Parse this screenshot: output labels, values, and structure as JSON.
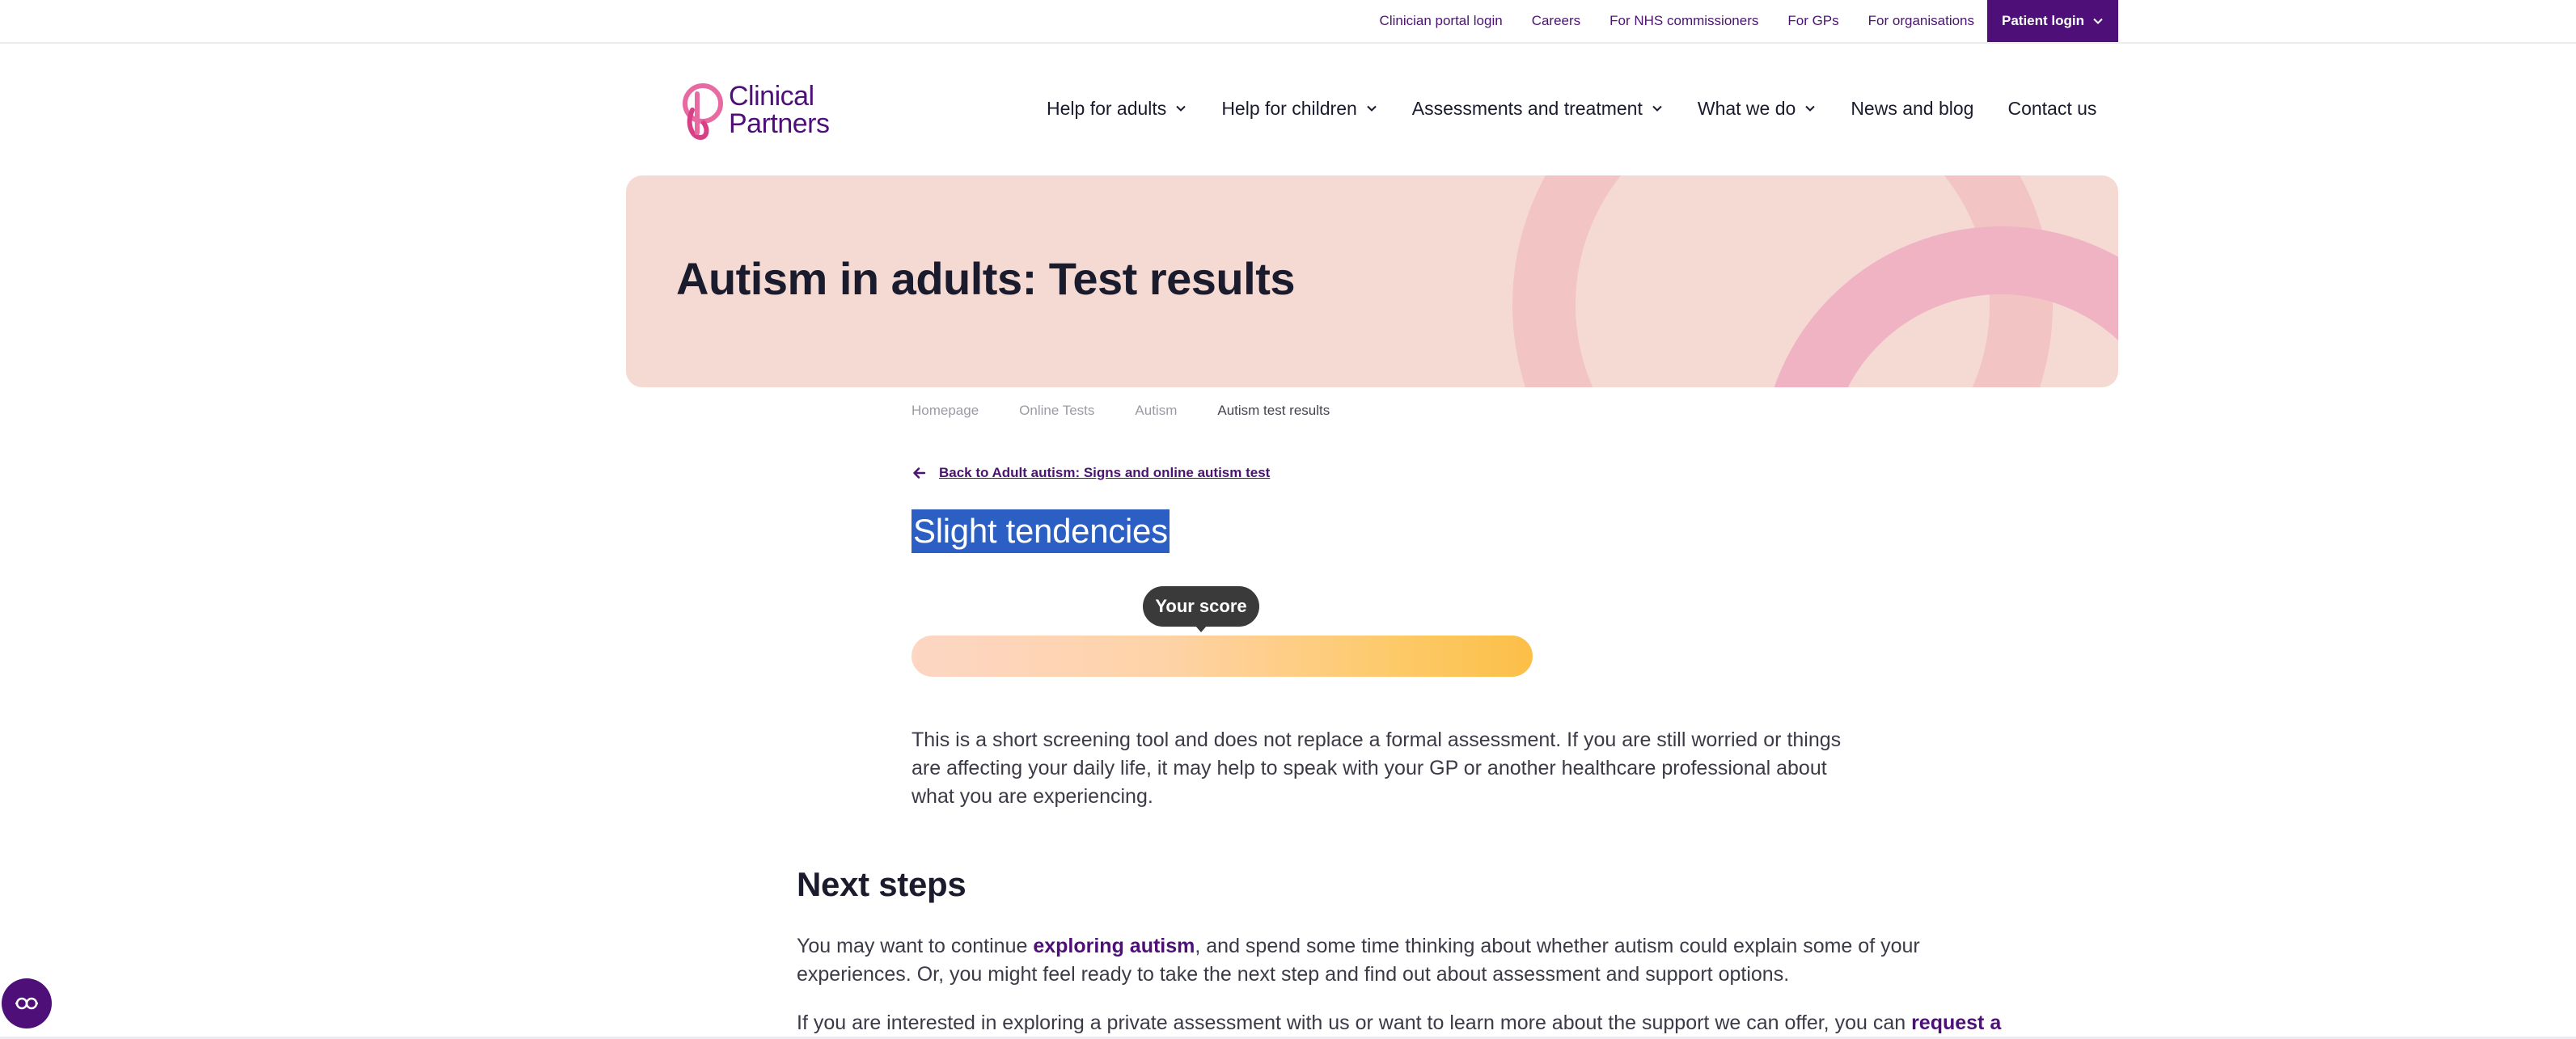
{
  "topbar": {
    "links": [
      "Clinician portal login",
      "Careers",
      "For NHS commissioners",
      "For GPs",
      "For organisations"
    ],
    "patient_login": "Patient login"
  },
  "logo": {
    "line1": "Clinical",
    "line2": "Partners"
  },
  "nav": {
    "items": [
      {
        "label": "Help for adults",
        "dropdown": true
      },
      {
        "label": "Help for children",
        "dropdown": true
      },
      {
        "label": "Assessments and treatment",
        "dropdown": true
      },
      {
        "label": "What we do",
        "dropdown": true
      },
      {
        "label": "News and blog",
        "dropdown": false
      },
      {
        "label": "Contact us",
        "dropdown": false
      }
    ]
  },
  "hero": {
    "title": "Autism in adults: Test results"
  },
  "breadcrumb": [
    "Homepage",
    "Online Tests",
    "Autism",
    "Autism test results"
  ],
  "back_link": "Back to Adult autism: Signs and online autism test",
  "result": {
    "title": "Slight tendencies",
    "tooltip": "Your score"
  },
  "disclaimer": "This is a short screening tool and does not replace a formal assessment. If you are still worried or things are affecting your daily life, it may help to speak with your GP or another healthcare professional about what you are experiencing.",
  "next_steps": {
    "title": "Next steps",
    "p1_before": "You may want to continue ",
    "p1_link": "exploring autism",
    "p1_after": ", and spend some time thinking about whether autism could explain some of your experiences. Or, you might feel ready to take the next step and find out about assessment and support options.",
    "p2_before": "If you are interested in exploring a private assessment with us or want to learn more about the support we can offer, you can ",
    "p2_link": "request a"
  },
  "colors": {
    "brand_purple": "#4e0f78",
    "hero_bg": "#f5dad3",
    "selection": "#2b5fc4"
  },
  "icons": {
    "dropdown": "chevron-down-icon",
    "back": "arrow-left-icon",
    "accessibility": "accessibility-icon"
  }
}
